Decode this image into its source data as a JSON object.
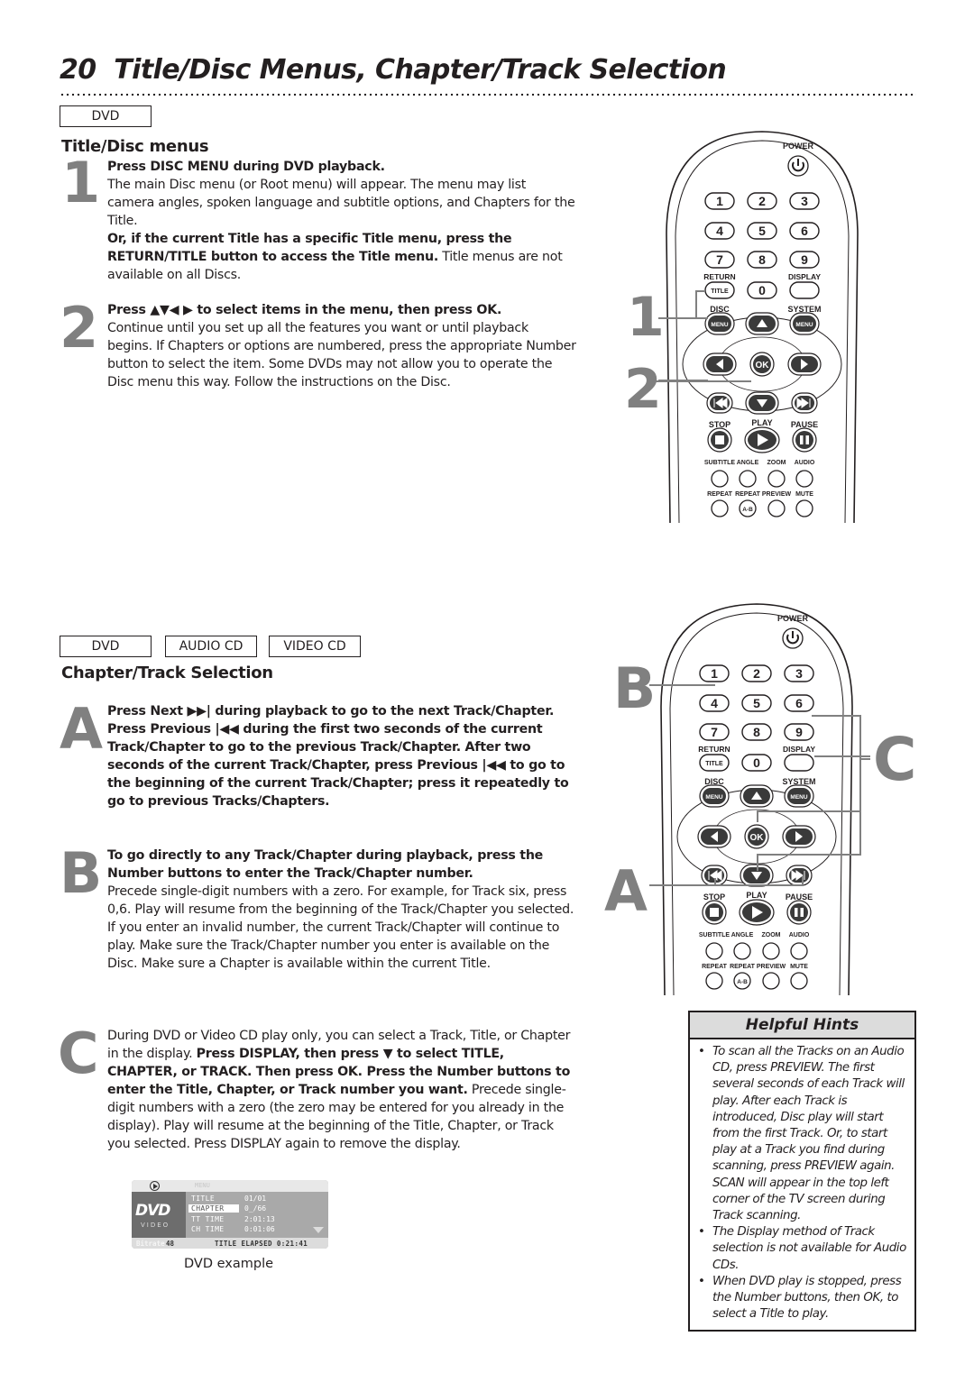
{
  "page": {
    "number": "20",
    "title": "Title/Disc Menus, Chapter/Track Selection"
  },
  "section1": {
    "disc_tags": [
      "DVD"
    ],
    "heading": "Title/Disc menus",
    "steps": [
      {
        "num": "1",
        "bold1": "Press DISC MENU during DVD playback.",
        "text1": "The main Disc menu (or Root menu) will appear. The menu may list camera angles, spoken language and subtitle options, and Chapters for the Title.",
        "bold2": "Or, if the current Title has a specific Title menu, press the RETURN/TITLE button to access the Title menu.",
        "text2": " Title menus are not available on all Discs."
      },
      {
        "num": "2",
        "bold1": "Press ▲▼◀ ▶ to select items in the menu, then press OK.",
        "text1": "Continue until you set up all the features you want or until playback begins. If Chapters or options are numbered, press the appropriate Number button to select the item. Some DVDs may not allow you to operate the Disc menu this way. Follow the instructions on the Disc."
      }
    ]
  },
  "section2": {
    "disc_tags": [
      "DVD",
      "AUDIO CD",
      "VIDEO CD"
    ],
    "heading": "Chapter/Track Selection",
    "steps": [
      {
        "letter": "A",
        "bold1": "Press Next ▶▶| during playback to go to the next Track/Chapter. Press Previous |◀◀ during the first two seconds of the current Track/Chapter to go to the previous Track/Chapter.  After two seconds of the current Track/Chapter, press Previous |◀◀  to go to the beginning of the current Track/Chapter; press it repeatedly to go to previous Tracks/Chapters."
      },
      {
        "letter": "B",
        "bold1": "To go directly to any Track/Chapter during playback, press the Number buttons to enter the Track/Chapter number.",
        "text1": "Precede single-digit numbers with a zero. For example, for Track six, press 0,6. Play will resume from the beginning of the Track/Chapter you selected.",
        "text2": "If you enter an invalid number, the current Track/Chapter will continue to play. Make sure the Track/Chapter number you enter is available on the Disc. Make sure a Chapter is available within the current Title."
      },
      {
        "letter": "C",
        "text0": "During DVD or Video CD play only, you can select a Track, Title, or Chapter in the display. ",
        "bold1": "Press DISPLAY, then press ▼ to select TITLE, CHAPTER, or TRACK. Then press OK. Press the Number buttons to enter the Title, Chapter, or Track number you want.",
        "text1": " Precede single-digit numbers with a zero (the zero may be entered for you already in the display). Play will resume at the beginning of the Title, Chapter, or Track you selected. Press DISPLAY again to remove the display."
      }
    ]
  },
  "dvd_example": {
    "menu_label": "MENU",
    "logo": "DVD",
    "logo_sub": "VIDEO",
    "rows": [
      {
        "label": "TITLE",
        "value": "01/01"
      },
      {
        "label": "CHAPTER",
        "value": "0_/66"
      },
      {
        "label": "TT TIME",
        "value": "2:01:13"
      },
      {
        "label": "CH TIME",
        "value": "0:01:06"
      }
    ],
    "bitrate_label": "Bitrate",
    "bitrate_value": "48",
    "elapsed": "TITLE ELAPSED 0:21:41",
    "caption": "DVD example"
  },
  "remote": {
    "power": "POWER",
    "digits": [
      "1",
      "2",
      "3",
      "4",
      "5",
      "6",
      "7",
      "8",
      "9",
      "0"
    ],
    "return_label": "RETURN",
    "title_btn": "TITLE",
    "display_label": "DISPLAY",
    "disc_label": "DISC",
    "system_label": "SYSTEM",
    "menu_btn": "MENU",
    "ok_btn": "OK",
    "stop_label": "STOP",
    "play_label": "PLAY",
    "pause_label": "PAUSE",
    "row1_labels": [
      "SUBTITLE",
      "ANGLE",
      "ZOOM",
      "AUDIO"
    ],
    "row2_labels": [
      "REPEAT",
      "REPEAT",
      "PREVIEW",
      "MUTE"
    ],
    "ab_btn": "A-B"
  },
  "callouts": {
    "remote1": [
      "1",
      "2"
    ],
    "remote2": [
      "B",
      "C",
      "A"
    ]
  },
  "hints": {
    "title": "Helpful Hints",
    "items": [
      "To scan all the Tracks on an Audio CD, press PREVIEW. The first several seconds of each Track will play. After each Track is introduced, Disc play will start from the first Track. Or, to start play at a Track you find during scanning, press PREVIEW again. SCAN will appear in the top left corner of the TV screen during Track scanning.",
      "The Display method of Track selection is not available for Audio CDs.",
      "When DVD play is stopped, press the Number buttons, then OK, to select a Title to play."
    ]
  }
}
